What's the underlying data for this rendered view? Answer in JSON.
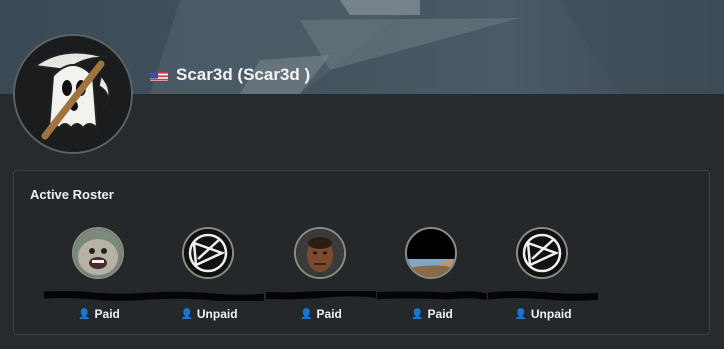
{
  "profile": {
    "name": "Scar3d (Scar3d )",
    "flag": "us-flag-icon"
  },
  "roster": {
    "title": "Active Roster",
    "members": [
      {
        "avatar": "seal-avatar",
        "status": "Paid"
      },
      {
        "avatar": "logo-avatar",
        "status": "Unpaid"
      },
      {
        "avatar": "man-avatar",
        "status": "Paid"
      },
      {
        "avatar": "landscape-avatar",
        "status": "Paid"
      },
      {
        "avatar": "logo-avatar",
        "status": "Unpaid"
      }
    ]
  },
  "colors": {
    "paid_icon": "#7fd0e0",
    "unpaid_icon": "#e07a8e",
    "background": "#272b2d"
  }
}
